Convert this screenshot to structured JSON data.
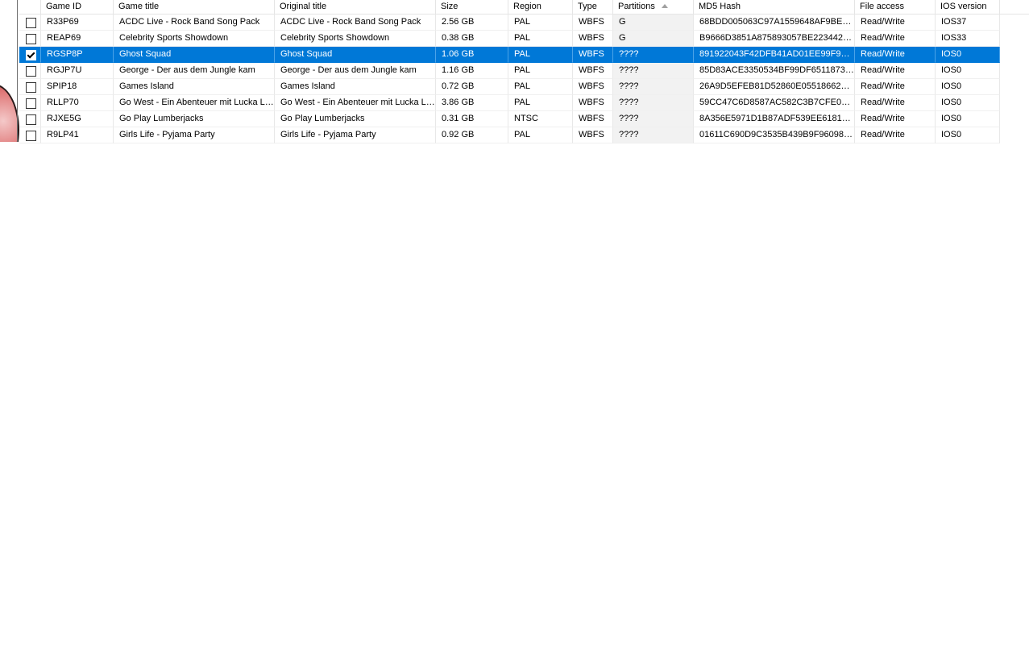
{
  "columns": [
    "Game ID",
    "Game title",
    "Original title",
    "Size",
    "Region",
    "Type",
    "Partitions",
    "MD5 Hash",
    "File access",
    "IOS version"
  ],
  "sorted_column": "Partitions",
  "sort_direction": "ascending",
  "selection_color": "#0078d7",
  "rows": [
    {
      "checked": false,
      "selected": false,
      "id": "R33P69",
      "title": "ACDC Live - Rock Band Song Pack",
      "original": "ACDC Live - Rock Band Song Pack",
      "size": "2.56 GB",
      "region": "PAL",
      "type": "WBFS",
      "partitions": "G",
      "md5": "68BDD005063C97A1559648AF9BEB…",
      "access": "Read/Write",
      "ios": "IOS37"
    },
    {
      "checked": false,
      "selected": false,
      "id": "REAP69",
      "title": "Celebrity Sports Showdown",
      "original": "Celebrity Sports Showdown",
      "size": "0.38 GB",
      "region": "PAL",
      "type": "WBFS",
      "partitions": "G",
      "md5": "B9666D3851A875893057BE223442…",
      "access": "Read/Write",
      "ios": "IOS33"
    },
    {
      "checked": true,
      "selected": true,
      "id": "RGSP8P",
      "title": "Ghost Squad",
      "original": "Ghost Squad",
      "size": "1.06 GB",
      "region": "PAL",
      "type": "WBFS",
      "partitions": "????",
      "md5": "891922043F42DFB41AD01EE99F9E…",
      "access": "Read/Write",
      "ios": "IOS0"
    },
    {
      "checked": false,
      "selected": false,
      "id": "RGJP7U",
      "title": "George - Der aus dem Jungle kam",
      "original": "George - Der aus dem Jungle kam",
      "size": "1.16 GB",
      "region": "PAL",
      "type": "WBFS",
      "partitions": "????",
      "md5": "85D83ACE3350534BF99DF6511873…",
      "access": "Read/Write",
      "ios": "IOS0"
    },
    {
      "checked": false,
      "selected": false,
      "id": "SPIP18",
      "title": "Games Island",
      "original": "Games Island",
      "size": "0.72 GB",
      "region": "PAL",
      "type": "WBFS",
      "partitions": "????",
      "md5": "26A9D5EFEB81D52860E055186620…",
      "access": "Read/Write",
      "ios": "IOS0"
    },
    {
      "checked": false,
      "selected": false,
      "id": "RLLP70",
      "title": "Go West - Ein Abenteuer mit Lucka L…",
      "original": "Go West - Ein Abenteuer mit Lucka L…",
      "size": "3.86 GB",
      "region": "PAL",
      "type": "WBFS",
      "partitions": "????",
      "md5": "59CC47C6D8587AC582C3B7CFE04…",
      "access": "Read/Write",
      "ios": "IOS0"
    },
    {
      "checked": false,
      "selected": false,
      "id": "RJXE5G",
      "title": "Go Play Lumberjacks",
      "original": "Go Play Lumberjacks",
      "size": "0.31 GB",
      "region": "NTSC",
      "type": "WBFS",
      "partitions": "????",
      "md5": "8A356E5971D1B87ADF539EE61819…",
      "access": "Read/Write",
      "ios": "IOS0"
    },
    {
      "checked": false,
      "selected": false,
      "id": "R9LP41",
      "title": "Girls Life - Pyjama Party",
      "original": "Girls Life - Pyjama Party",
      "size": "0.92 GB",
      "region": "PAL",
      "type": "WBFS",
      "partitions": "????",
      "md5": "01611C690D9C3535B439B9F96098…",
      "access": "Read/Write",
      "ios": "IOS0"
    }
  ]
}
